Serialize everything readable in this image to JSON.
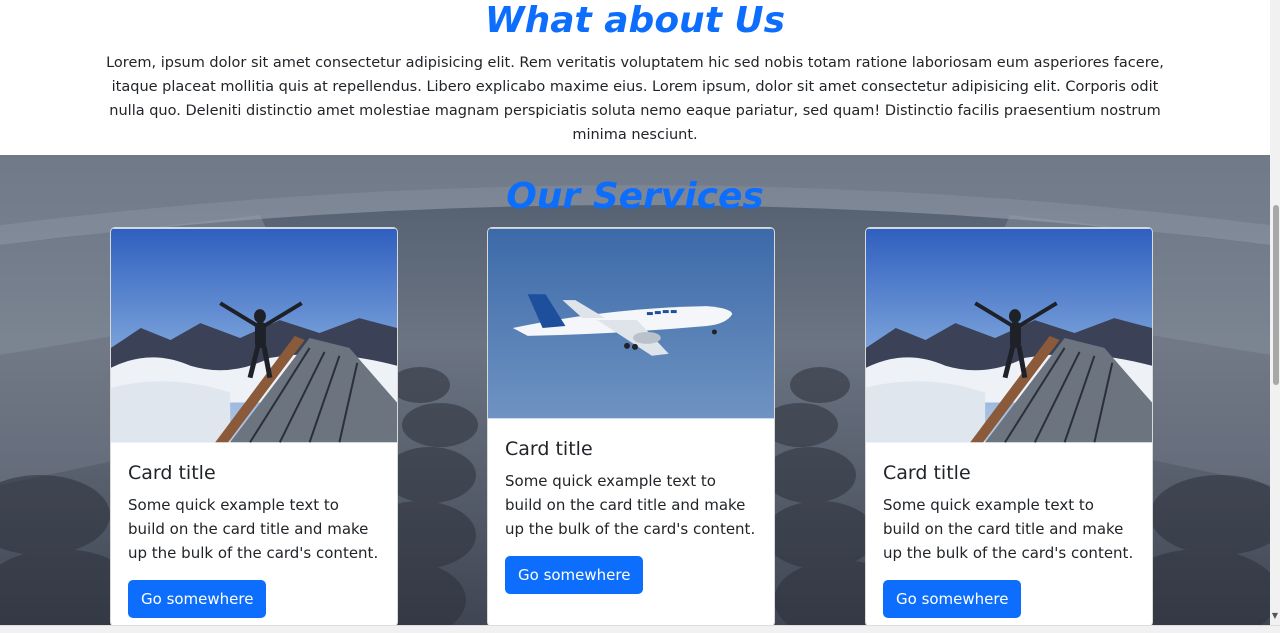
{
  "about": {
    "title": "What about Us",
    "text": "Lorem, ipsum dolor sit amet consectetur adipisicing elit. Rem veritatis voluptatem hic sed nobis totam ratione laboriosam eum asperiores facere, itaque placeat mollitia quis at repellendus. Libero explicabo maxime eius. Lorem ipsum, dolor sit amet consectetur adipisicing elit. Corporis odit nulla quo. Deleniti distinctio amet molestiae magnam perspiciatis soluta nemo eaque pariatur, sed quam! Distinctio facilis praesentium nostrum minima nesciunt."
  },
  "services": {
    "title": "Our Services",
    "cards": [
      {
        "image": "person-on-mountain-balcony",
        "title": "Card title",
        "text": "Some quick example text to build on the card title and make up the bulk of the card's content.",
        "button": "Go somewhere"
      },
      {
        "image": "airplane-in-sky",
        "title": "Card title",
        "text": "Some quick example text to build on the card title and make up the bulk of the card's content.",
        "button": "Go somewhere"
      },
      {
        "image": "person-on-mountain-balcony",
        "title": "Card title",
        "text": "Some quick example text to build on the card title and make up the bulk of the card's content.",
        "button": "Go somewhere"
      }
    ]
  },
  "colors": {
    "accent": "#0d6efd",
    "text": "#212529",
    "background": "#ffffff"
  }
}
